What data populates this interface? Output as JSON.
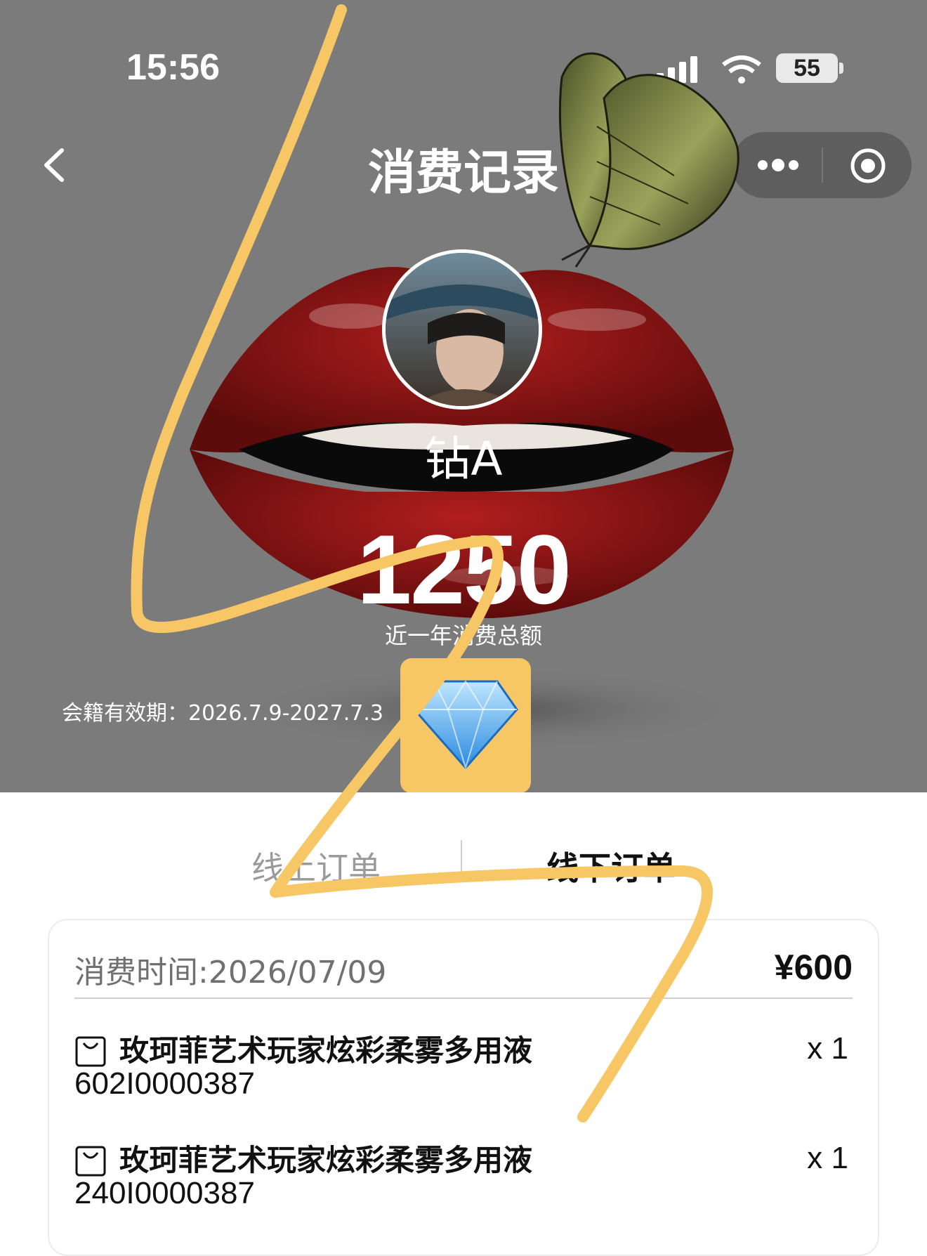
{
  "status_bar": {
    "time": "15:56",
    "battery": "55",
    "icons": [
      "signal-icon",
      "wifi-icon",
      "battery-icon"
    ]
  },
  "header": {
    "title": "消费记录",
    "back_icon": "chevron-left-icon",
    "more_icon": "more-icon",
    "close_icon": "target-icon"
  },
  "profile": {
    "username": "钻A",
    "total_amount": "1250",
    "total_label": "近一年消费总额",
    "membership": "会籍有效期：2026.7.9-2027.7.3",
    "badge_icon": "diamond-icon"
  },
  "tabs": [
    {
      "label": "线上订单",
      "active": false
    },
    {
      "label": "线下订单",
      "active": true
    }
  ],
  "order": {
    "time": "消费时间:2026/07/09",
    "total": "¥600",
    "items": [
      {
        "name": "玫珂菲艺术玩家炫彩柔雾多用液",
        "code": "602I0000387",
        "qty": "x 1"
      },
      {
        "name": "玫珂菲艺术玩家炫彩柔雾多用液",
        "code": "240I0000387",
        "qty": "x 1"
      }
    ]
  },
  "colors": {
    "hero_bg": "#7b7b7b",
    "badge": "#f8c765",
    "scribble": "#f8c765"
  }
}
